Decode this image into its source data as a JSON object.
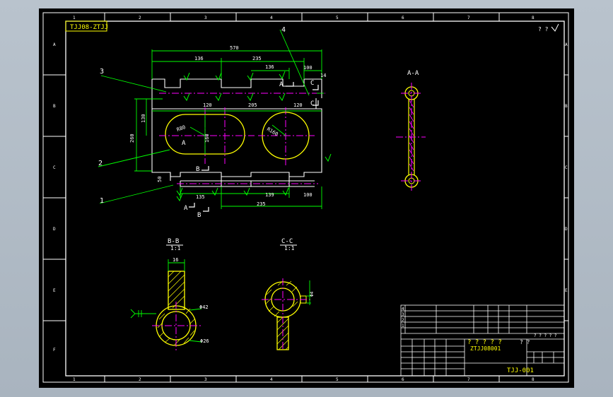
{
  "drawing": {
    "title_code": "TJJ08-ZTJJ",
    "roughness_mark": "? ?",
    "zone_numbers": [
      "1",
      "2",
      "3",
      "4",
      "5",
      "6",
      "7",
      "8"
    ],
    "zone_letters": [
      "A",
      "B",
      "C",
      "D",
      "E",
      "F"
    ],
    "leaders": [
      "3",
      "4",
      "2",
      "1"
    ],
    "dims": {
      "d570": "570",
      "d136": "136",
      "d235a": "235",
      "d136b": "136",
      "d100a": "100",
      "d14": "14",
      "d120a": "120",
      "d205": "205",
      "d120b": "120",
      "d130": "130",
      "d260": "260",
      "d160": "160",
      "r80": "R80",
      "r160": "R160",
      "d50": "50",
      "d135": "135",
      "d139": "139",
      "d235b": "235",
      "d100b": "100",
      "d16": "16",
      "phi42": "Φ42",
      "phi26": "Φ26",
      "phi4": "Φ4"
    },
    "section_marks": {
      "a1": "A",
      "c1": "C",
      "c2": "C",
      "a2": "A",
      "b1": "B",
      "a3": "A",
      "b2": "B",
      "a_center": "A"
    },
    "view_titles": {
      "aa": "A-A",
      "bb": "B-B",
      "bb_scale": "1:1",
      "cc": "C-C",
      "cc_scale": "1:1"
    },
    "title_block": {
      "rows": [
        "4",
        "3",
        "2",
        "1"
      ],
      "big_text": "? ? ? ? ?",
      "drawing_no": "ZTJJ08001",
      "right_top": "? ?",
      "scale_text": "? ? ? ? ?",
      "bottom_code": "TJJ-001"
    }
  }
}
